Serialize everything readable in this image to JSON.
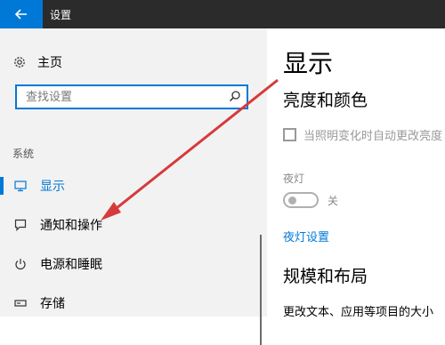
{
  "titlebar": {
    "title": "设置"
  },
  "sidebar": {
    "home_label": "主页",
    "search_placeholder": "查找设置",
    "section_label": "系统",
    "items": [
      {
        "label": "显示",
        "icon": "monitor-icon",
        "active": true
      },
      {
        "label": "通知和操作",
        "icon": "notification-icon",
        "active": false
      },
      {
        "label": "电源和睡眠",
        "icon": "power-icon",
        "active": false
      },
      {
        "label": "存储",
        "icon": "storage-icon",
        "active": false
      }
    ]
  },
  "main": {
    "title": "显示",
    "brightness_heading": "亮度和颜色",
    "auto_brightness_label": "当照明变化时自动更改亮度",
    "night_light_label": "夜灯",
    "night_light_state": "关",
    "night_light_link": "夜灯设置",
    "scale_heading": "规模和布局",
    "scale_desc": "更改文本、应用等项目的大小"
  },
  "colors": {
    "accent": "#0078d7",
    "titlebar": "#2b2b2b",
    "sidebar_bg": "#f2f2f2",
    "annotation_arrow": "#d63a3a"
  }
}
